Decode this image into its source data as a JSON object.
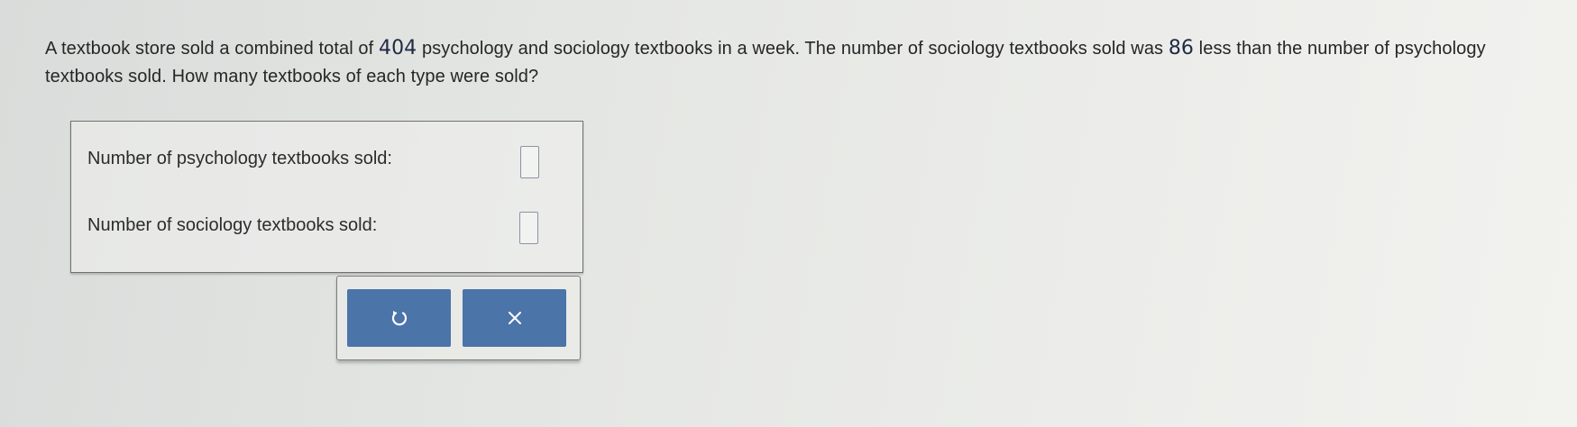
{
  "question": {
    "part1": "A textbook store sold a combined total of ",
    "total": "404",
    "part2": " psychology and sociology textbooks in a week. The number of sociology textbooks sold was ",
    "difference": "86",
    "part3": " less than the number of psychology textbooks sold. How many textbooks of each type were sold?"
  },
  "answers": {
    "psychology_label": "Number of psychology textbooks sold:",
    "psychology_value": "",
    "sociology_label": "Number of sociology textbooks sold:",
    "sociology_value": ""
  },
  "buttons": {
    "undo_icon": "undo-icon",
    "clear_icon": "close-icon"
  },
  "colors": {
    "button_blue": "#4b74a9",
    "input_border": "#8a94a8"
  }
}
